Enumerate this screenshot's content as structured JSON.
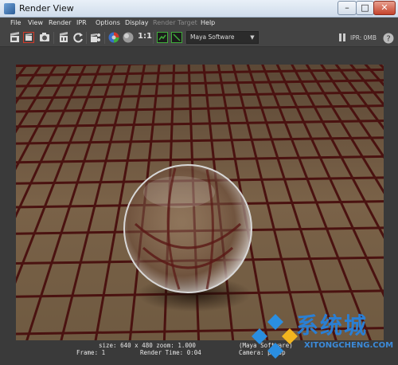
{
  "window": {
    "title": "Render View",
    "minimize_label": "–",
    "maximize_label": "□",
    "close_label": "✕"
  },
  "menubar": {
    "items": [
      {
        "label": "File",
        "enabled": true
      },
      {
        "label": "View",
        "enabled": true
      },
      {
        "label": "Render",
        "enabled": true
      },
      {
        "label": "IPR",
        "enabled": true
      },
      {
        "label": "Options",
        "enabled": true
      },
      {
        "label": "Display",
        "enabled": true
      },
      {
        "label": "Render Target",
        "enabled": false
      },
      {
        "label": "Help",
        "enabled": true
      }
    ]
  },
  "toolbar": {
    "ratio_label": "1:1",
    "renderer": "Maya Software",
    "ipr_status": "IPR: 0MB"
  },
  "status": {
    "line1": "size: 640 x 480 zoom: 1.000",
    "line1_right": "(Maya Software)",
    "line2": "Frame: 1",
    "line2_mid": "Render Time: 0:04",
    "line2_right": "Camera: persp"
  },
  "watermark": {
    "text": "系统城",
    "url": "XITONGCHENG.COM"
  },
  "colors": {
    "floor": "#6f5a41",
    "grid": "#4a1210",
    "ui_bg": "#444444"
  }
}
